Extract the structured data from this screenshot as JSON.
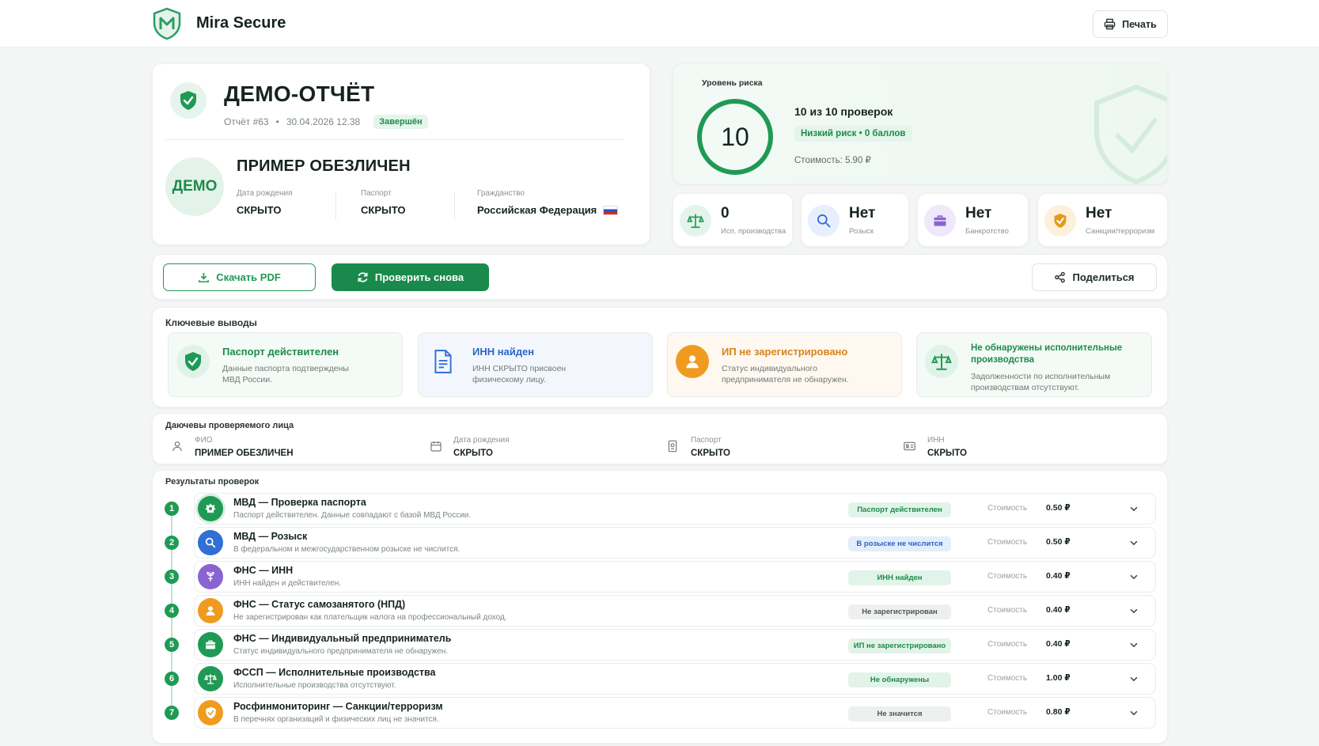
{
  "header": {
    "brand": "Mira Secure",
    "print_label": "Печать"
  },
  "report": {
    "title": "ДЕМО-ОТЧЁТ",
    "number": "Отчёт #63",
    "datetime": "30.04.2026 12.38",
    "status": "Завершён",
    "avatar_text": "ДЕМО",
    "person_name": "ПРИМЕР ОБЕЗЛИЧЕН",
    "fields": [
      {
        "label": "Дата рождения",
        "value": "СКРЫТО"
      },
      {
        "label": "Паспорт",
        "value": "СКРЫТО"
      },
      {
        "label": "Гражданство",
        "value": "Российская Федерация"
      }
    ]
  },
  "risk": {
    "label": "Уровень риска",
    "score": "10",
    "checks": "10 из 10 проверок",
    "level": "Низкий риск • 0 баллов",
    "cost": "Стоимость: 5.90 ₽",
    "accent": "#1f9a55"
  },
  "stats": [
    {
      "value": "0",
      "label": "Исп. производства",
      "icon": "scales-icon",
      "color": "#1f9a55"
    },
    {
      "value": "Нет",
      "label": "Розыск",
      "icon": "search-icon",
      "color": "#2f6fd6"
    },
    {
      "value": "Нет",
      "label": "Банкротство",
      "icon": "briefcase-icon",
      "color": "#8a63d2"
    },
    {
      "value": "Нет",
      "label": "Санкции/терроризм",
      "icon": "shield-check-icon",
      "color": "#e59a1a"
    }
  ],
  "actions": {
    "download": "Скачать PDF",
    "recheck": "Проверить снова",
    "share": "Поделиться"
  },
  "findings": {
    "title": "Ключевые выводы",
    "items": [
      {
        "title": "Паспорт действителен",
        "desc1": "Данные паспорта подтверждены",
        "desc2": "МВД России.",
        "icon": "shield-check-icon"
      },
      {
        "title": "ИНН найден",
        "desc1": "ИНН СКРЫТО присвоен",
        "desc2": "физическому лицу.",
        "icon": "document-icon"
      },
      {
        "title": "ИП не зарегистрировано",
        "desc1": "Статус индивидуального",
        "desc2": "предпринимателя не обнаружен.",
        "icon": "user-icon"
      },
      {
        "title1": "Не обнаружены исполнительные",
        "title2": "производства",
        "desc1": "Задолженности по исполнительным",
        "desc2": "производствам отсутствуют.",
        "icon": "scales-icon"
      }
    ]
  },
  "person": {
    "title": "Даючевы проверяемого лица",
    "fields": [
      {
        "label": "ФИО",
        "value": "ПРИМЕР ОБЕЗЛИЧЕН",
        "icon": "user-icon"
      },
      {
        "label": "Дата рождения",
        "value": "СКРЫТО",
        "icon": "calendar-icon"
      },
      {
        "label": "Паспорт",
        "value": "СКРЫТО",
        "icon": "passport-icon"
      },
      {
        "label": "ИНН",
        "value": "СКРЫТО",
        "icon": "id-card-icon"
      }
    ]
  },
  "results": {
    "title": "Результаты проверок",
    "cost_label": "Стоимость",
    "items": [
      {
        "n": "1",
        "title": "МВД — Проверка паспорта",
        "desc": "Паспорт действителен. Данные совпадают с базой МВД России.",
        "badge": "Паспорт действителен",
        "cost": "0.50 ₽",
        "icon": "emblem-icon"
      },
      {
        "n": "2",
        "title": "МВД — Розыск",
        "desc": "В федеральном и межгосударственном розыске не числится.",
        "badge": "В розыске не числится",
        "cost": "0.50 ₽",
        "icon": "search-icon"
      },
      {
        "n": "3",
        "title": "ФНС — ИНН",
        "desc": "ИНН найден и действителен.",
        "badge": "ИНН найден",
        "cost": "0.40 ₽",
        "icon": "emblem-icon"
      },
      {
        "n": "4",
        "title": "ФНС — Статус самозанятого (НПД)",
        "desc": "Не зарегистрирован как плательщик налога на профессиональный доход.",
        "badge": "Не зарегистрирован",
        "cost": "0.40 ₽",
        "icon": "user-icon"
      },
      {
        "n": "5",
        "title": "ФНС — Индивидуальный предприниматель",
        "desc": "Статус индивидуального предпринимателя не обнаружен.",
        "badge": "ИП не зарегистрировано",
        "cost": "0.40 ₽",
        "icon": "briefcase-icon"
      },
      {
        "n": "6",
        "title": "ФССП — Исполнительные производства",
        "desc": "Исполнительные производства отсутствуют.",
        "badge": "Не обнаружены",
        "cost": "1.00 ₽",
        "icon": "scales-icon"
      },
      {
        "n": "7",
        "title": "Росфинмониторинг — Санкции/терроризм",
        "desc": "В перечнях организаций и физических лиц не значится.",
        "badge": "Не значится",
        "cost": "0.80 ₽",
        "icon": "shield-check-icon"
      }
    ]
  }
}
